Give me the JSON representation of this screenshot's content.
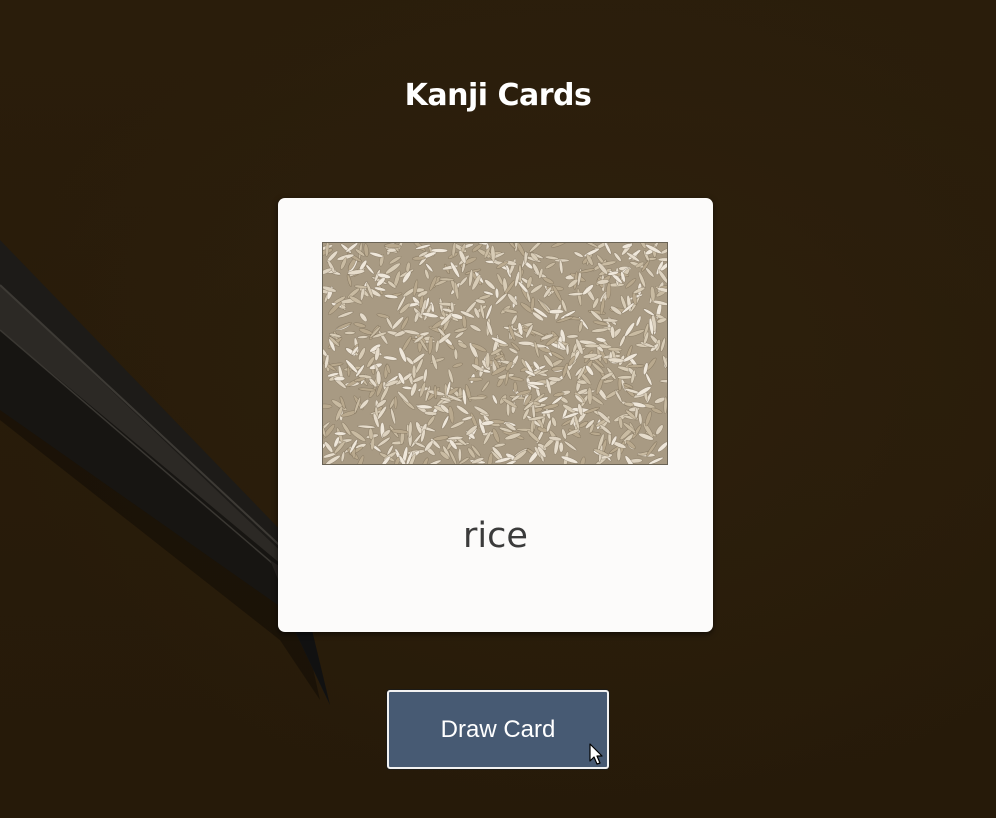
{
  "page": {
    "title": "Kanji Cards"
  },
  "card": {
    "image": "rice-grains-photo",
    "word": "rice"
  },
  "actions": {
    "draw_label": "Draw Card"
  },
  "colors": {
    "background": "#291c0a",
    "card": "#fcfbfa",
    "button": "#475a73",
    "title": "#ffffff"
  },
  "icons": {
    "cursor": "mouse-pointer-icon",
    "decor": "pencil-decoration"
  }
}
